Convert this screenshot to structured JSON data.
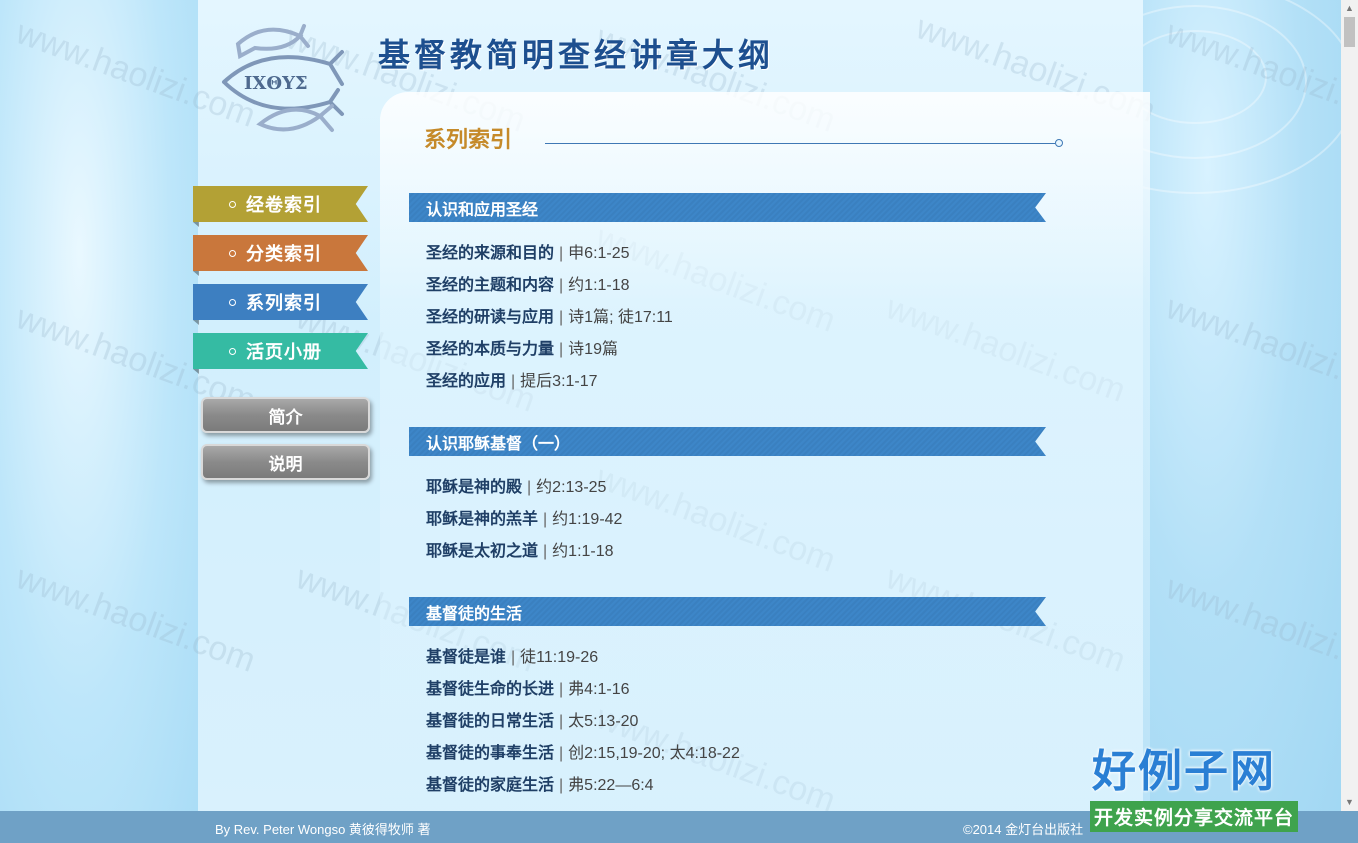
{
  "site_title": "基督教简明查经讲章大纲",
  "logo_text": "ΙΧΘΥΣ",
  "section_heading": "系列索引",
  "nav": {
    "items": [
      {
        "label": "经卷索引",
        "color": "#b3a135"
      },
      {
        "label": "分类索引",
        "color": "#c9773c"
      },
      {
        "label": "系列索引",
        "color": "#3d7fc1"
      },
      {
        "label": "活页小册",
        "color": "#35bba3"
      }
    ],
    "buttons": [
      {
        "label": "简介"
      },
      {
        "label": "说明"
      }
    ]
  },
  "categories": [
    {
      "title": "认识和应用圣经",
      "entries": [
        {
          "title": "圣经的来源和目的",
          "ref": "申6:1-25"
        },
        {
          "title": "圣经的主题和内容",
          "ref": "约1:1-18"
        },
        {
          "title": "圣经的研读与应用",
          "ref": "诗1篇; 徒17:11"
        },
        {
          "title": "圣经的本质与力量",
          "ref": "诗19篇"
        },
        {
          "title": "圣经的应用",
          "ref": "提后3:1-17"
        }
      ]
    },
    {
      "title": "认识耶稣基督（一）",
      "entries": [
        {
          "title": "耶稣是神的殿",
          "ref": "约2:13-25"
        },
        {
          "title": "耶稣是神的羔羊",
          "ref": "约1:19-42"
        },
        {
          "title": "耶稣是太初之道",
          "ref": "约1:1-18"
        }
      ]
    },
    {
      "title": "基督徒的生活",
      "entries": [
        {
          "title": "基督徒是谁",
          "ref": "徒11:19-26"
        },
        {
          "title": "基督徒生命的长进",
          "ref": "弗4:1-16"
        },
        {
          "title": "基督徒的日常生活",
          "ref": "太5:13-20"
        },
        {
          "title": "基督徒的事奉生活",
          "ref": "创2:15,19-20; 太4:18-22"
        },
        {
          "title": "基督徒的家庭生活",
          "ref": "弗5:22—6:4"
        }
      ]
    }
  ],
  "separator": "|",
  "footer": {
    "author": "By Rev. Peter Wongso 黄彼得牧师 著",
    "copyright": "©2014 金灯台出版社"
  },
  "watermark_text": "www.haolizi.com",
  "brand": {
    "title": "好例子网",
    "subtitle": "开发实例分享交流平台"
  },
  "colors": {
    "heading": "#c58a2a",
    "category_bar": "#3d86c8",
    "entry_title": "#1f3f66",
    "footer": "#6fa1c6"
  }
}
